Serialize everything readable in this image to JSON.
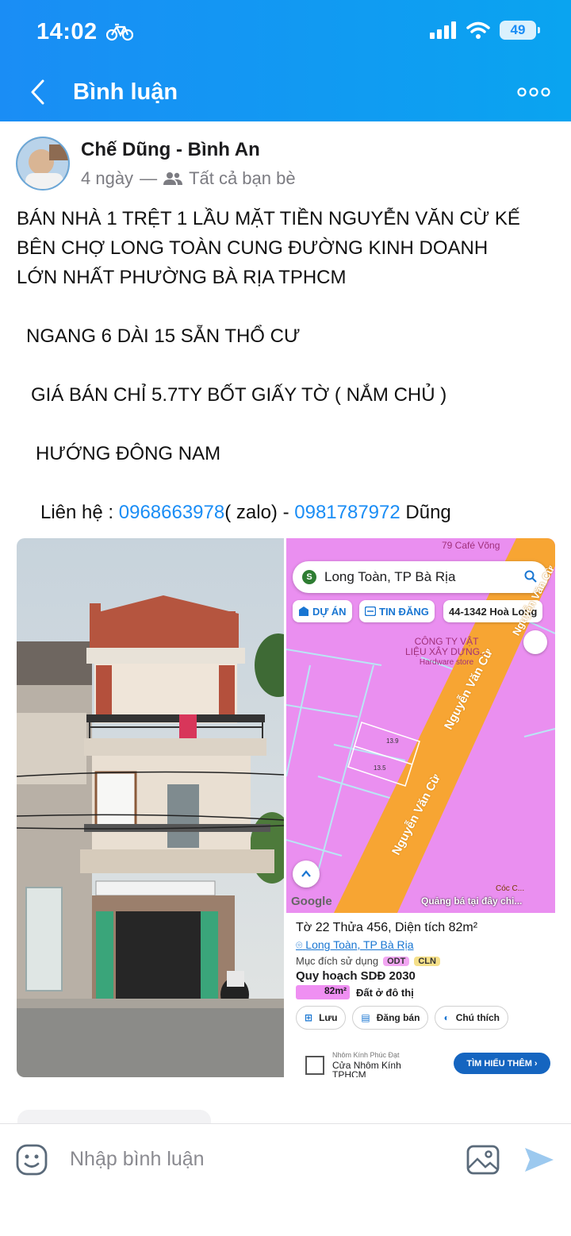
{
  "status_bar": {
    "time": "14:02",
    "battery": "49"
  },
  "header": {
    "title": "Bình luận"
  },
  "post": {
    "author": "Chế Dũng - Bình An",
    "time_ago": "4 ngày",
    "separator": "—",
    "audience": "Tất cả bạn bè",
    "lines": [
      "BÁN NHÀ 1 TRỆT 1 LẦU MẶT TIỀN NGUYỄN VĂN CỪ KẾ",
      "BÊN CHỢ LONG TOÀN CUNG ĐƯỜNG KINH DOANH",
      "LỚN NHẤT PHƯỜNG BÀ RỊA TPHCM"
    ],
    "size_line": "NGANG 6 DÀI 15 SẴN THỔ CƯ",
    "price_line": "GIÁ BÁN CHỈ 5.7TY BỐT GIẤY TỜ ( NẮM CHỦ )",
    "direction_line": "HƯỚNG ĐÔNG NAM",
    "contact_prefix": "Liên hệ : ",
    "phone1": "0968663978",
    "contact_mid": "( zalo) - ",
    "phone2": "0981787972",
    "contact_suffix": " Dũng"
  },
  "map_screenshot": {
    "top_cut_text": "79 Café Võng",
    "search_badge": "S",
    "search_text": "Long Toàn, TP Bà Rịa",
    "chip_project": "DỰ ÁN",
    "chip_listing": "TIN ĐĂNG",
    "chip_parcel": "44-1342 Hoà Long",
    "poi_line1": "CÔNG TY VẬT",
    "poi_line2": "LIỆU XÂY DỰNG...",
    "poi_line3": "Hardware store",
    "parcel_edge1": "13.9",
    "parcel_edge2": "13.5",
    "road1": "Nguyễn Văn Cừ",
    "road2": "Nguyễn Văn Cừ",
    "road3": "Nguyễn Văn Cừ",
    "cafe": "Cóc C...",
    "ad_banner": "Quảng bá tại đây chi...",
    "google": "Google",
    "info_title": "Tờ 22 Thửa 456, Diện tích 82m²",
    "info_ward": "Long Toàn",
    "info_city": "TP Bà Rịa",
    "info_use_label": "Mục đích sử dụng",
    "tag1": "ODT",
    "tag2": "CLN",
    "info_plan": "Quy hoạch SDĐ 2030",
    "area_value": "82m²",
    "area_label": "Đất ở đô thị",
    "btn_save": "Lưu",
    "btn_post": "Đăng bán",
    "btn_legend": "Chú thích",
    "ad_company": "Nhôm Kính Phúc Đạt",
    "ad_line1": "Cửa Nhôm Kính",
    "ad_line2": "TPHCM",
    "ad_cta": "TÌM HIỂU THÊM"
  },
  "comment_bar": {
    "placeholder": "Nhập bình luận"
  },
  "colors": {
    "header_blue": "#1a8df5",
    "link_blue": "#1a8df5",
    "map_pink": "#ea8ff0",
    "road_orange": "#f7a533"
  }
}
